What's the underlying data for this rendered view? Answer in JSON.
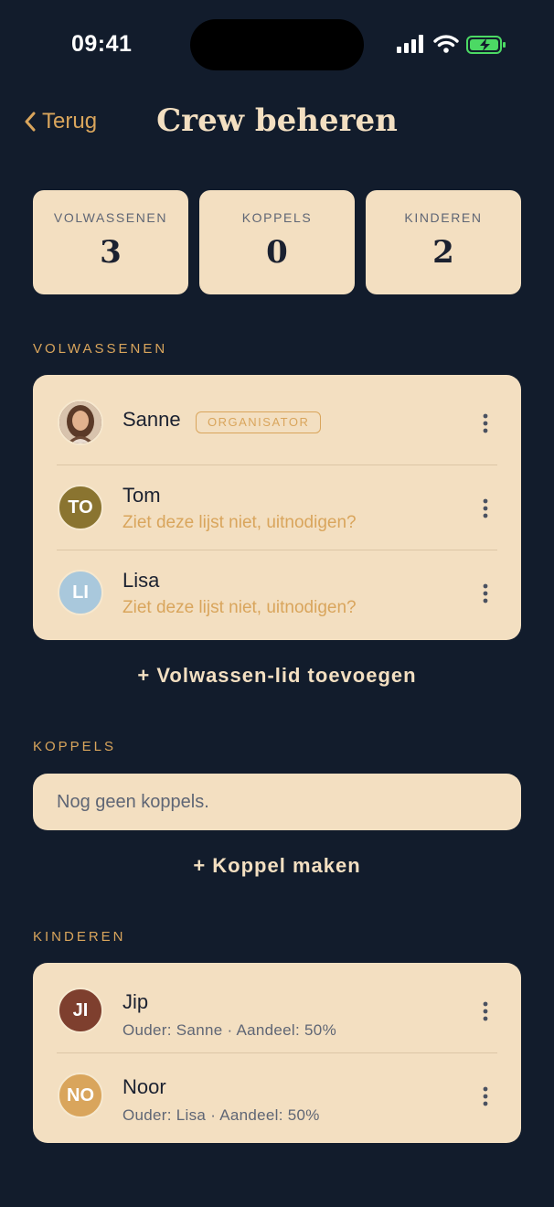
{
  "status_bar": {
    "time": "09:41"
  },
  "nav": {
    "back_label": "Terug",
    "title": "Crew beheren"
  },
  "stats": [
    {
      "label": "VOLWASSENEN",
      "value": "3"
    },
    {
      "label": "KOPPELS",
      "value": "0"
    },
    {
      "label": "KINDEREN",
      "value": "2"
    }
  ],
  "adults": {
    "heading": "VOLWASSENEN",
    "members": [
      {
        "name": "Sanne",
        "badge": "ORGANISATOR"
      },
      {
        "name": "Tom",
        "initials": "TO",
        "note": "Ziet deze lijst niet, uitnodigen?",
        "color": "#8a7430"
      },
      {
        "name": "Lisa",
        "initials": "LI",
        "note": "Ziet deze lijst niet, uitnodigen?",
        "color": "#a9c8dc"
      }
    ],
    "add_label": "+ Volwassen-lid toevoegen"
  },
  "couples": {
    "heading": "KOPPELS",
    "empty_text": "Nog geen koppels.",
    "add_label": "+ Koppel maken"
  },
  "children": {
    "heading": "KINDEREN",
    "members": [
      {
        "name": "Jip",
        "initials": "JI",
        "details": "Ouder: Sanne · Aandeel: 50%",
        "color": "#7e3f2e"
      },
      {
        "name": "Noor",
        "initials": "NO",
        "details": "Ouder: Lisa · Aandeel: 50%",
        "color": "#d9a55c"
      }
    ]
  },
  "colors": {
    "background": "#121c2c",
    "card": "#f3dfc1",
    "accent": "#d9a55c"
  }
}
